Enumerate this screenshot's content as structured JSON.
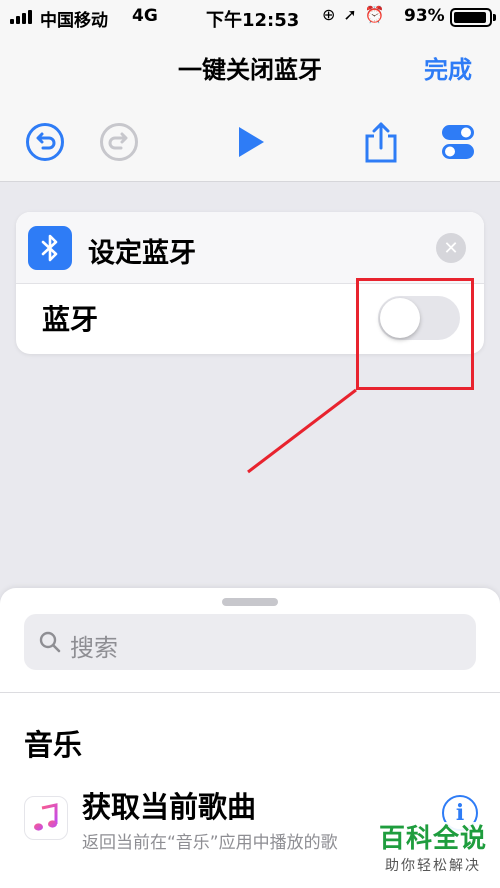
{
  "status_bar": {
    "carrier": "中国移动",
    "network": "4G",
    "time": "下午12:53",
    "battery_percent": "93%",
    "battery_level": 0.93
  },
  "nav": {
    "title": "一键关闭蓝牙",
    "done_label": "完成"
  },
  "toolbar": {
    "icons": [
      "undo-icon",
      "redo-icon",
      "play-icon",
      "share-icon",
      "settings-toggle-icon"
    ]
  },
  "action_card": {
    "title": "设定蓝牙",
    "row_label": "蓝牙",
    "toggle_on": false
  },
  "sheet": {
    "search_placeholder": "搜索",
    "section_title": "音乐",
    "item": {
      "title": "获取当前歌曲",
      "subtitle": "返回当前在“音乐”应用中播放的歌"
    }
  },
  "watermark": {
    "main": "百科全说",
    "sub": "助你轻松解决"
  },
  "colors": {
    "accent": "#2e7cf6",
    "annotation": "#e8232e",
    "watermark_green": "#1f9d3e"
  }
}
